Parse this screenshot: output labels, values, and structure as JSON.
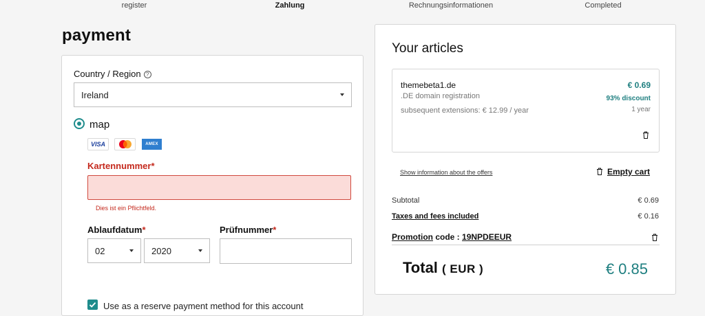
{
  "steps": [
    {
      "label": "register"
    },
    {
      "label": "Zahlung"
    },
    {
      "label": "Rechnungsinformationen"
    },
    {
      "label": "Completed"
    }
  ],
  "page_title": "payment",
  "payment_form": {
    "country_label": "Country / Region",
    "country_value": "Ireland",
    "method_label": "map",
    "card_logos": {
      "visa": "VISA",
      "mastercard": "mastercard-icon",
      "amex": "AMEX"
    },
    "card_number_label": "Kartennummer",
    "required_mark": "*",
    "card_number_value": "",
    "card_number_error": "Dies ist ein Pflichtfeld.",
    "expiry_label": "Ablaufdatum",
    "expiry_month": "02",
    "expiry_year": "2020",
    "cvv_label": "Prüfnummer",
    "cvv_value": "",
    "reserve_checkbox_label": "Use as a reserve payment method for this account"
  },
  "summary": {
    "title": "Your articles",
    "item": {
      "name": "themebeta1.de",
      "description": ".DE domain registration",
      "extensions": "subsequent extensions: € 12.99 / year",
      "price": "€ 0.69",
      "discount": "93% discount",
      "term": "1 year"
    },
    "offers_link": "Show information about the offers",
    "empty_cart": "Empty cart",
    "subtotal_label": "Subtotal",
    "subtotal_value": "€ 0.69",
    "taxes_label": "Taxes and fees included",
    "taxes_value": "€ 0.16",
    "promotion_label": "Promotion",
    "promotion_code_text": "code :",
    "promotion_code": "19NPDEEUR",
    "total_label": "Total",
    "total_currency": "( EUR )",
    "total_value": "€ 0.85"
  },
  "colors": {
    "accent": "#1f8c8c",
    "error": "#c4281c",
    "error_bg": "#fbdcd9"
  }
}
